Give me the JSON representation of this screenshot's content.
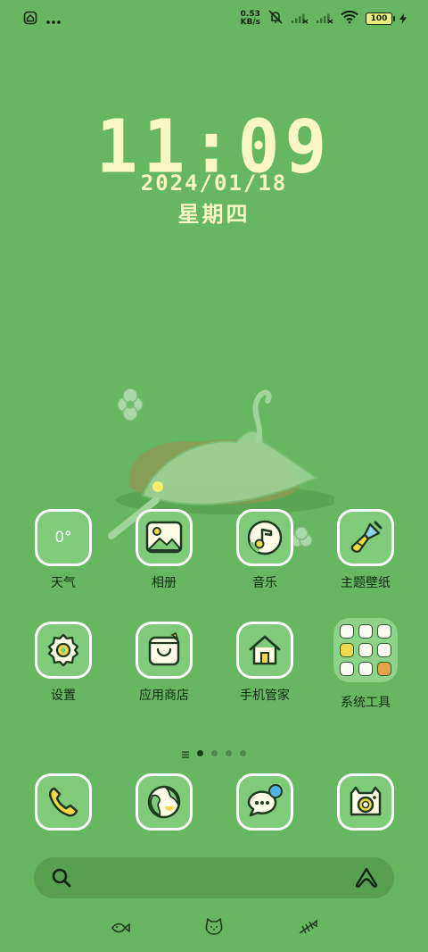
{
  "status_bar": {
    "net_speed_value": "0.53",
    "net_speed_unit": "KB/s",
    "battery": "100"
  },
  "clock": {
    "time": "11:09",
    "date": "2024/01/18",
    "weekday": "星期四"
  },
  "apps": [
    {
      "label": "天气",
      "icon": "weather-icon",
      "value": "0°"
    },
    {
      "label": "相册",
      "icon": "gallery-icon"
    },
    {
      "label": "音乐",
      "icon": "music-icon"
    },
    {
      "label": "主题壁纸",
      "icon": "brush-icon"
    },
    {
      "label": "设置",
      "icon": "gear-icon"
    },
    {
      "label": "应用商店",
      "icon": "store-bag-icon"
    },
    {
      "label": "手机管家",
      "icon": "home-shield-icon"
    },
    {
      "label": "系统工具",
      "icon": "folder-icon"
    }
  ],
  "page_indicator": {
    "pages": 4,
    "current": 1
  },
  "dock": [
    {
      "icon": "phone-icon"
    },
    {
      "icon": "browser-globe-icon"
    },
    {
      "icon": "messages-icon"
    },
    {
      "icon": "camera-icon"
    }
  ],
  "search": {
    "icon": "search-icon",
    "assistant_icon": "assistant-icon"
  },
  "bottom_nav": [
    {
      "icon": "fish-icon"
    },
    {
      "icon": "cat-icon"
    },
    {
      "icon": "fishbone-icon"
    }
  ],
  "colors": {
    "background": "#67b661",
    "clock": "#f7f6c4",
    "tile_border": "#ffffff",
    "tile_fill": "#7fcb7a"
  }
}
